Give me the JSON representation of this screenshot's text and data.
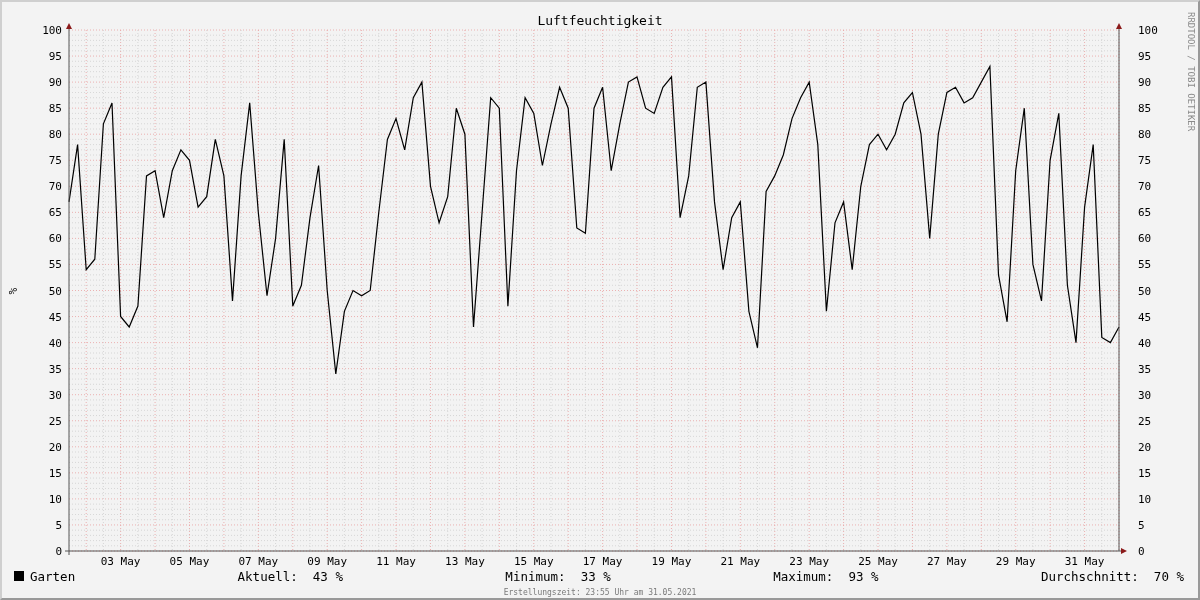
{
  "chart": {
    "credit": "RRDTOOL / TOBI OETIKER",
    "right_axis_ticks": [
      "100",
      "95",
      "90",
      "85",
      "80",
      "75",
      "70",
      "65",
      "60",
      "55",
      "50",
      "45",
      "40",
      "35",
      "30",
      "25",
      "20",
      "15",
      "10",
      "5",
      "0"
    ],
    "chart_data": {
      "type": "line",
      "title": "Luftfeuchtigkeit",
      "ylabel": "%",
      "ylim": [
        0,
        100
      ],
      "grid": true,
      "yticks": [
        0,
        5,
        10,
        15,
        20,
        25,
        30,
        35,
        40,
        45,
        50,
        55,
        60,
        65,
        70,
        75,
        80,
        85,
        90,
        95,
        100
      ],
      "categories": [
        null,
        null,
        null,
        null,
        null,
        null,
        "03 May",
        null,
        null,
        null,
        null,
        null,
        null,
        null,
        "05 May",
        null,
        null,
        null,
        null,
        null,
        null,
        null,
        "07 May",
        null,
        null,
        null,
        null,
        null,
        null,
        null,
        "09 May",
        null,
        null,
        null,
        null,
        null,
        null,
        null,
        "11 May",
        null,
        null,
        null,
        null,
        null,
        null,
        null,
        "13 May",
        null,
        null,
        null,
        null,
        null,
        null,
        null,
        "15 May",
        null,
        null,
        null,
        null,
        null,
        null,
        null,
        "17 May",
        null,
        null,
        null,
        null,
        null,
        null,
        null,
        "19 May",
        null,
        null,
        null,
        null,
        null,
        null,
        null,
        "21 May",
        null,
        null,
        null,
        null,
        null,
        null,
        null,
        "23 May",
        null,
        null,
        null,
        null,
        null,
        null,
        null,
        "25 May",
        null,
        null,
        null,
        null,
        null,
        null,
        null,
        "27 May",
        null,
        null,
        null,
        null,
        null,
        null,
        null,
        "29 May",
        null,
        null,
        null,
        null,
        null,
        null,
        null,
        "31 May",
        null,
        null,
        null,
        null
      ],
      "series": [
        {
          "name": "Garten",
          "color": "#000000",
          "values": [
            67,
            78,
            54,
            56,
            82,
            86,
            45,
            43,
            47,
            72,
            73,
            64,
            73,
            77,
            75,
            66,
            68,
            79,
            72,
            48,
            72,
            86,
            65,
            49,
            60,
            79,
            47,
            51,
            64,
            74,
            50,
            34,
            46,
            50,
            49,
            50,
            65,
            79,
            83,
            77,
            87,
            90,
            70,
            63,
            68,
            85,
            80,
            43,
            65,
            87,
            85,
            47,
            73,
            87,
            84,
            74,
            82,
            89,
            85,
            62,
            61,
            85,
            89,
            73,
            82,
            90,
            91,
            85,
            84,
            89,
            91,
            64,
            72,
            89,
            90,
            67,
            54,
            64,
            67,
            46,
            39,
            69,
            72,
            76,
            83,
            87,
            90,
            78,
            46,
            63,
            67,
            54,
            70,
            78,
            80,
            77,
            80,
            86,
            88,
            80,
            60,
            80,
            88,
            89,
            86,
            87,
            90,
            93,
            53,
            44,
            73,
            85,
            55,
            48,
            75,
            84,
            51,
            40,
            66,
            78,
            41,
            40,
            43
          ]
        }
      ]
    }
  },
  "legend": {
    "stats": [
      {
        "label": "Aktuell:",
        "value": "43 %"
      },
      {
        "label": "Minimum:",
        "value": "33 %"
      },
      {
        "label": "Maximum:",
        "value": "93 %"
      },
      {
        "label": "Durchschnitt:",
        "value": "70 %"
      }
    ]
  },
  "footer": "Erstellungszeit: 23:55 Uhr am 31.05.2021"
}
